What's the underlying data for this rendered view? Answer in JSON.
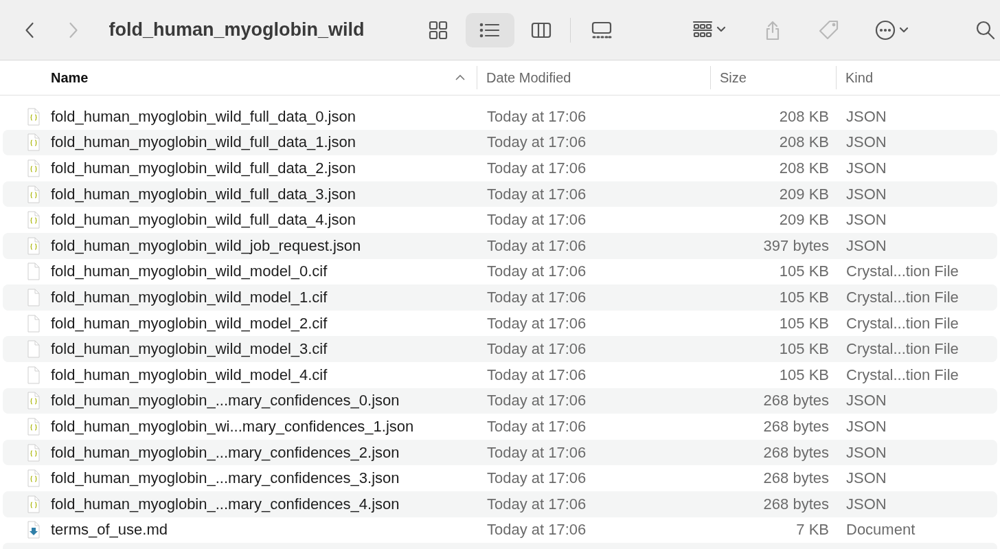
{
  "toolbar": {
    "title": "fold_human_myoglobin_wild",
    "nav": [
      {
        "kind": "back",
        "disabled": false
      },
      {
        "kind": "forward",
        "disabled": true
      }
    ],
    "views": [
      {
        "kind": "icons",
        "selected": false
      },
      {
        "kind": "list",
        "selected": true
      },
      {
        "kind": "columns",
        "selected": false
      },
      {
        "kind": "gallery",
        "selected": false
      }
    ],
    "actions": [
      {
        "kind": "group",
        "disabled": false
      },
      {
        "kind": "share",
        "disabled": true
      },
      {
        "kind": "tag",
        "disabled": true
      },
      {
        "kind": "more",
        "disabled": false
      },
      {
        "kind": "search",
        "disabled": false
      }
    ]
  },
  "columns": [
    {
      "label": "Name",
      "sorted": true
    },
    {
      "label": "Date Modified",
      "sorted": false
    },
    {
      "label": "Size",
      "sorted": false
    },
    {
      "label": "Kind",
      "sorted": false
    }
  ],
  "files": [
    {
      "kind": "json",
      "name": "fold_human_myoglobin_wild_full_data_0.json",
      "date": "Today at 17:06",
      "size": "208 KB",
      "type": "JSON"
    },
    {
      "kind": "json",
      "name": "fold_human_myoglobin_wild_full_data_1.json",
      "date": "Today at 17:06",
      "size": "208 KB",
      "type": "JSON"
    },
    {
      "kind": "json",
      "name": "fold_human_myoglobin_wild_full_data_2.json",
      "date": "Today at 17:06",
      "size": "208 KB",
      "type": "JSON"
    },
    {
      "kind": "json",
      "name": "fold_human_myoglobin_wild_full_data_3.json",
      "date": "Today at 17:06",
      "size": "209 KB",
      "type": "JSON"
    },
    {
      "kind": "json",
      "name": "fold_human_myoglobin_wild_full_data_4.json",
      "date": "Today at 17:06",
      "size": "209 KB",
      "type": "JSON"
    },
    {
      "kind": "json",
      "name": "fold_human_myoglobin_wild_job_request.json",
      "date": "Today at 17:06",
      "size": "397 bytes",
      "type": "JSON"
    },
    {
      "kind": "blank",
      "name": "fold_human_myoglobin_wild_model_0.cif",
      "date": "Today at 17:06",
      "size": "105 KB",
      "type": "Crystal...tion File"
    },
    {
      "kind": "blank",
      "name": "fold_human_myoglobin_wild_model_1.cif",
      "date": "Today at 17:06",
      "size": "105 KB",
      "type": "Crystal...tion File"
    },
    {
      "kind": "blank",
      "name": "fold_human_myoglobin_wild_model_2.cif",
      "date": "Today at 17:06",
      "size": "105 KB",
      "type": "Crystal...tion File"
    },
    {
      "kind": "blank",
      "name": "fold_human_myoglobin_wild_model_3.cif",
      "date": "Today at 17:06",
      "size": "105 KB",
      "type": "Crystal...tion File"
    },
    {
      "kind": "blank",
      "name": "fold_human_myoglobin_wild_model_4.cif",
      "date": "Today at 17:06",
      "size": "105 KB",
      "type": "Crystal...tion File"
    },
    {
      "kind": "json",
      "name": "fold_human_myoglobin_...mary_confidences_0.json",
      "date": "Today at 17:06",
      "size": "268 bytes",
      "type": "JSON"
    },
    {
      "kind": "json",
      "name": "fold_human_myoglobin_wi...mary_confidences_1.json",
      "date": "Today at 17:06",
      "size": "268 bytes",
      "type": "JSON"
    },
    {
      "kind": "json",
      "name": "fold_human_myoglobin_...mary_confidences_2.json",
      "date": "Today at 17:06",
      "size": "268 bytes",
      "type": "JSON"
    },
    {
      "kind": "json",
      "name": "fold_human_myoglobin_...mary_confidences_3.json",
      "date": "Today at 17:06",
      "size": "268 bytes",
      "type": "JSON"
    },
    {
      "kind": "json",
      "name": "fold_human_myoglobin_...mary_confidences_4.json",
      "date": "Today at 17:06",
      "size": "268 bytes",
      "type": "JSON"
    },
    {
      "kind": "download",
      "name": "terms_of_use.md",
      "date": "Today at 17:06",
      "size": "7 KB",
      "type": "Document"
    }
  ]
}
